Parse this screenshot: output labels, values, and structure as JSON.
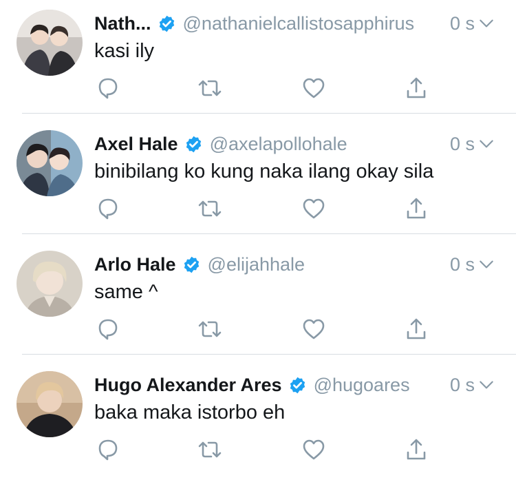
{
  "colors": {
    "verified": "#1da1f2",
    "muted": "#8899a6",
    "text": "#14171a",
    "icon": "#8899a6",
    "divider": "#d7dde2"
  },
  "icons": {
    "verified": "verified-badge-icon",
    "menu": "chevron-down-icon",
    "reply": "reply-icon",
    "retweet": "retweet-icon",
    "like": "heart-icon",
    "share": "share-icon"
  },
  "tweets": [
    {
      "name": "Nath...",
      "handle": "@nathanielcallistosapphirus",
      "time": "0 s",
      "text": "kasi ily"
    },
    {
      "name": "Axel Hale",
      "handle": "@axelapollohale",
      "time": "0 s",
      "text": "binibilang ko kung naka ilang okay sila"
    },
    {
      "name": "Arlo Hale",
      "handle": "@elijahhale",
      "time": "0 s",
      "text": "same ^"
    },
    {
      "name": "Hugo Alexander Ares",
      "handle": "@hugoares",
      "time": "0 s",
      "text": "baka maka istorbo eh"
    }
  ]
}
